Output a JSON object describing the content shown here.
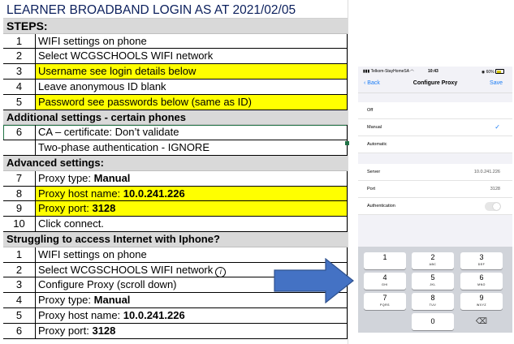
{
  "sheet": {
    "title": "LEARNER BROADBAND LOGIN AS AT 2021/02/05",
    "steps_header": "STEPS:",
    "steps": [
      {
        "num": "1",
        "text": "WIFI settings on phone"
      },
      {
        "num": "2",
        "text": "Select WCGSCHOOLS WIFI network"
      },
      {
        "num": "3",
        "text": "Username see login details below"
      },
      {
        "num": "4",
        "text": "Leave anonymous ID blank"
      },
      {
        "num": "5",
        "text": "Password see passwords below (same as ID)"
      }
    ],
    "additional_header": "Additional settings - certain phones",
    "additional": [
      {
        "num": "6",
        "text": "CA – certificate: Don’t validate"
      },
      {
        "num": "",
        "text": "Two-phase authentication - IGNORE"
      }
    ],
    "advanced_header": "Advanced settings:",
    "advanced": [
      {
        "num": "7",
        "label": "Proxy type: ",
        "value": "Manual"
      },
      {
        "num": "8",
        "label": "Proxy host name: ",
        "value": "10.0.241.226"
      },
      {
        "num": "9",
        "label": "Proxy port: ",
        "value": "3128"
      },
      {
        "num": "10",
        "label": "Click connect.",
        "value": ""
      }
    ],
    "iphone_header": "Struggling to access Internet with Iphone?",
    "iphone": [
      {
        "num": "1",
        "label": "WIFI settings on phone",
        "value": ""
      },
      {
        "num": "2",
        "label": "Select WCGSCHOOLS WIFI network",
        "value": ""
      },
      {
        "num": "3",
        "label": "Configure Proxy (scroll down)",
        "value": ""
      },
      {
        "num": "4",
        "label": "Proxy type: ",
        "value": "Manual"
      },
      {
        "num": "5",
        "label": "Proxy host name: ",
        "value": "10.0.241.226"
      },
      {
        "num": "6",
        "label": "Proxy port: ",
        "value": "3128"
      }
    ],
    "highlight_color": "#ffff00",
    "title_color": "#0b1f5c"
  },
  "phone": {
    "status": {
      "carrier": "Telkom-StayHomeSA",
      "time": "10:43",
      "battery": "60%"
    },
    "nav": {
      "back": "Back",
      "title": "Configure Proxy",
      "save": "Save"
    },
    "options": {
      "off": "Off",
      "manual": "Manual",
      "automatic": "Automatic"
    },
    "fields": {
      "server_label": "Server",
      "server_value": "10.0.241.226",
      "port_label": "Port",
      "port_value": "3128",
      "auth_label": "Authentication"
    },
    "keypad": [
      {
        "d": "1",
        "l": ""
      },
      {
        "d": "2",
        "l": "ABC"
      },
      {
        "d": "3",
        "l": "DEF"
      },
      {
        "d": "4",
        "l": "GHI"
      },
      {
        "d": "5",
        "l": "JKL"
      },
      {
        "d": "6",
        "l": "MNO"
      },
      {
        "d": "7",
        "l": "PQRS"
      },
      {
        "d": "8",
        "l": "TUV"
      },
      {
        "d": "9",
        "l": "WXYZ"
      },
      {
        "d": "0",
        "l": ""
      }
    ],
    "accent_color": "#1a7cf5"
  },
  "arrow_color": "#4472c4"
}
